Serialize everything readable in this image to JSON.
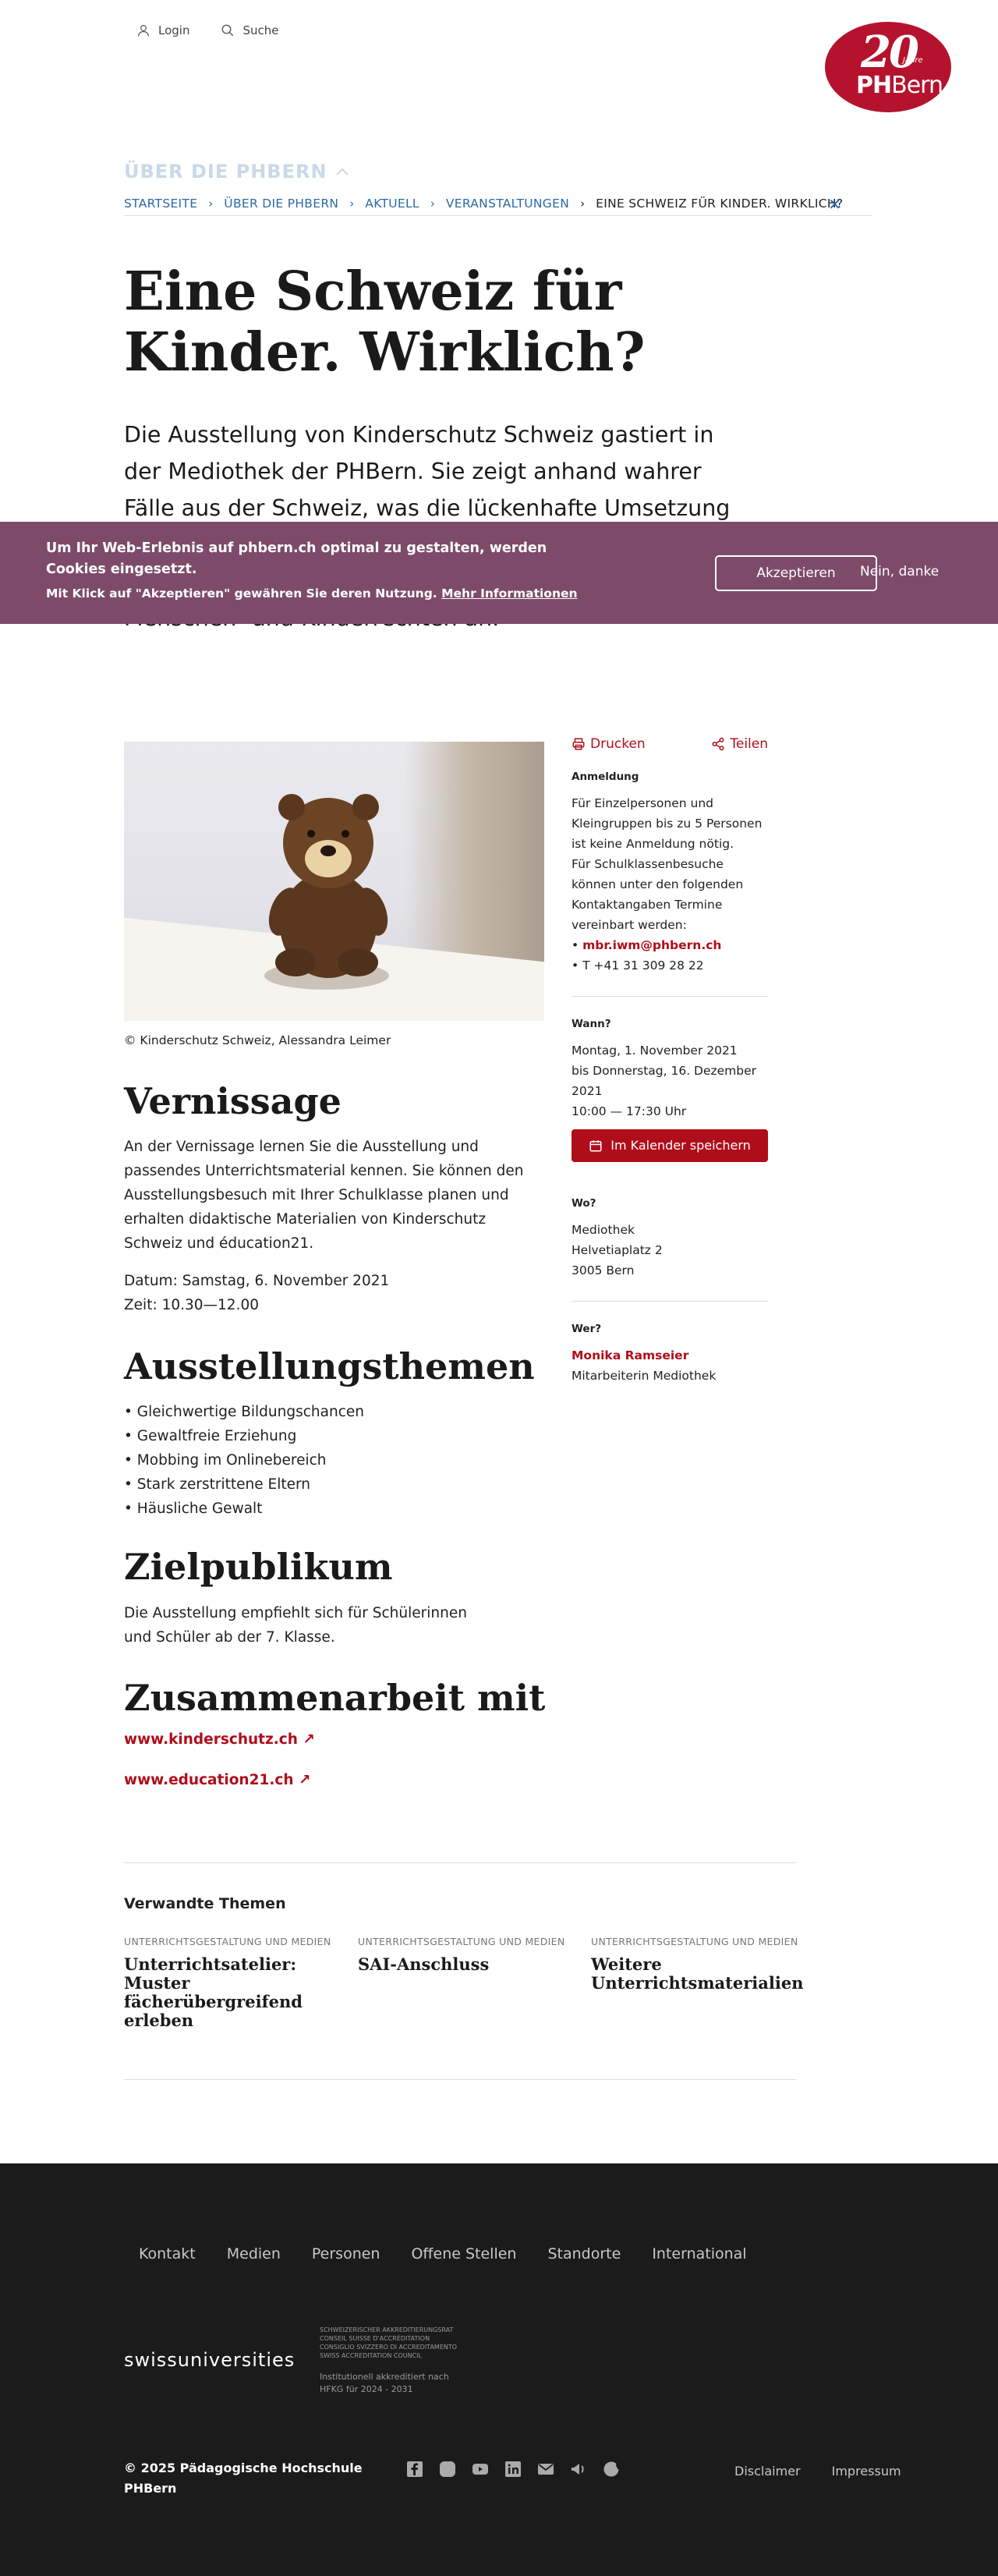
{
  "utility": {
    "login": "Login",
    "search": "Suche"
  },
  "logo": {
    "number": "20",
    "jahre": "Jahre",
    "brand_bold": "PH",
    "brand_rest": "Bern"
  },
  "section_label": "ÜBER DIE PHBERN",
  "breadcrumb": [
    "STARTSEITE",
    "ÜBER DIE PHBERN",
    "AKTUELL",
    "VERANSTALTUNGEN",
    "EINE SCHWEIZ FÜR KINDER. WIRKLICH?"
  ],
  "title": "Eine Schweiz für Kinder. Wirklich?",
  "lead": "Die Ausstellung von Kinderschutz Schweiz gastiert in der Mediothek der PHBern. Sie zeigt anhand wahrer Fälle aus der Schweiz, was die lückenhafte Umsetzung der UNO-Kinderrechtskonvention für Kinder bedeutet und bietet vielfältige Unterrichtsmaterialien zu Menschen- und Kinderrechten an.",
  "cookie": {
    "text1": "Um Ihr Web-Erlebnis auf phbern.ch optimal zu gestalten, werden Cookies eingesetzt.",
    "text2": "Mit Klick auf \"Akzeptieren\" gewähren Sie deren Nutzung.",
    "more": "Mehr Informationen",
    "accept": "Akzeptieren",
    "decline": "Nein, danke"
  },
  "image_caption": "© Kinderschutz Schweiz, Alessandra Leimer",
  "vernissage": {
    "heading": "Vernissage",
    "text": "An der Vernissage lernen Sie die Ausstellung und passendes Unterrichtsmaterial kennen. Sie können den Ausstellungsbesuch mit Ihrer Schulklasse planen und erhalten didaktische Materialien von Kinderschutz Schweiz und éducation21.",
    "date": "Datum: Samstag, 6. November 2021",
    "time": "Zeit: 10.30—12.00"
  },
  "themes": {
    "heading": "Ausstellungsthemen",
    "items": [
      "Gleichwertige Bildungschancen",
      "Gewaltfreie Erziehung",
      "Mobbing im Onlinebereich",
      "Stark zerstrittene Eltern",
      "Häusliche Gewalt"
    ]
  },
  "audience": {
    "heading": "Zielpublikum",
    "line1": "Die Ausstellung empfiehlt sich für Schülerinnen",
    "line2": "und Schüler ab der 7. Klasse."
  },
  "partners": {
    "heading": "Zusammenarbeit mit",
    "links": [
      "www.kinderschutz.ch",
      "www.education21.ch"
    ]
  },
  "sidebar": {
    "print": "Drucken",
    "share": "Teilen",
    "anmeldung_label": "Anmeldung",
    "anmeldung_text1": "Für Einzelpersonen und Kleingruppen bis zu 5 Personen ist keine Anmeldung nötig.",
    "anmeldung_text2": "Für Schulklassenbesuche können unter den folgenden Kontaktangaben Termine vereinbart werden:",
    "email": "mbr.iwm@phbern.ch",
    "phone": "T +41 31 309 28 22",
    "wann_label": "Wann?",
    "wann_from": "Montag, 1. November 2021",
    "wann_to": "bis Donnerstag, 16. Dezember 2021",
    "wann_time": "10:00 — 17:30 Uhr",
    "calendar": "Im Kalender speichern",
    "wo_label": "Wo?",
    "wo_1": "Mediothek",
    "wo_2": "Helvetiaplatz 2",
    "wo_3": "3005 Bern",
    "wer_label": "Wer?",
    "wer_name": "Monika Ramseier",
    "wer_role": "Mitarbeiterin Mediothek"
  },
  "related": {
    "heading": "Verwandte Themen",
    "items": [
      {
        "category": "UNTERRICHTSGESTALTUNG UND MEDIEN",
        "title": "Unterrichtsatelier: Muster fächerübergreifend erleben"
      },
      {
        "category": "UNTERRICHTSGESTALTUNG UND MEDIEN",
        "title": "SAI-Anschluss"
      },
      {
        "category": "UNTERRICHTSGESTALTUNG UND MEDIEN",
        "title": "Weitere Unterrichtsmaterialien"
      }
    ]
  },
  "footer": {
    "nav": [
      "Kontakt",
      "Medien",
      "Personen",
      "Offene Stellen",
      "Standorte",
      "International"
    ],
    "swissuniversities": "swissuniversities",
    "accred_lines": [
      "SCHWEIZERISCHER AKKREDITIERUNGSRAT",
      "CONSEIL SUISSE D'ACCRÉDITATION",
      "CONSIGLIO SVIZZERO DI ACCREDITAMENTO",
      "SWISS ACCREDITATION COUNCIL"
    ],
    "accred_note1": "Institutionell akkreditiert nach",
    "accred_note2": "HFKG für 2024 - 2031",
    "copyright1": "© 2025 Pädagogische Hochschule",
    "copyright2": "PHBern",
    "legal": [
      "Disclaimer",
      "Impressum"
    ]
  }
}
